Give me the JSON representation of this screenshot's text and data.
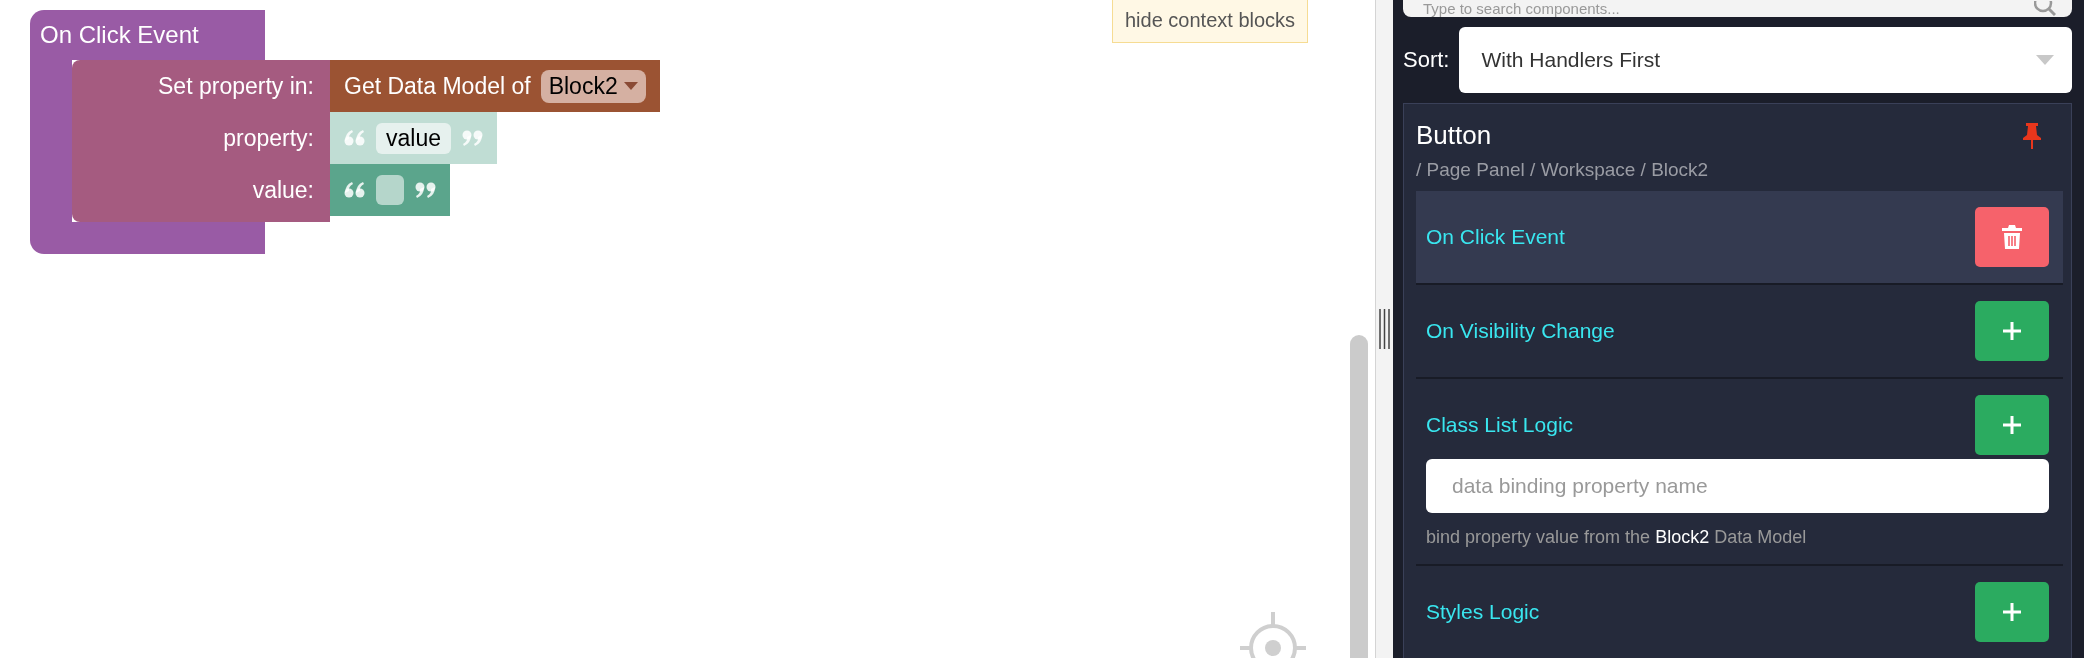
{
  "canvas": {
    "event_block": {
      "title": "On Click Event",
      "rows": [
        {
          "label": "Set property in:",
          "block": {
            "kind": "data_model",
            "text": "Get Data Model of",
            "dropdown": "Block2",
            "color": "#9b5333"
          }
        },
        {
          "label": "property:",
          "block": {
            "kind": "text",
            "value": "value",
            "color": "#c0ddd4"
          }
        },
        {
          "label": "value:",
          "block": {
            "kind": "text",
            "color": "#5ba58c"
          }
        }
      ]
    },
    "hide_context_button": "hide context blocks"
  },
  "panel": {
    "search": {
      "placeholder": "Type to search components..."
    },
    "sort": {
      "label": "Sort:",
      "value": "With Handlers First"
    },
    "component": {
      "title": "Button",
      "path": "/ Page Panel / Workspace / Block2",
      "pinned": true,
      "handlers": [
        {
          "label": "On Click Event",
          "selected": true,
          "kind": "delete"
        },
        {
          "label": "On Visibility Change",
          "selected": false,
          "kind": "add"
        },
        {
          "label": "Class List Logic",
          "selected": false,
          "kind": "add",
          "field": {
            "placeholder": "data binding property name"
          },
          "help": "bind property value from the **Block2** Data Model"
        },
        {
          "label": "Styles Logic",
          "selected": false,
          "kind": "add"
        }
      ]
    }
  }
}
